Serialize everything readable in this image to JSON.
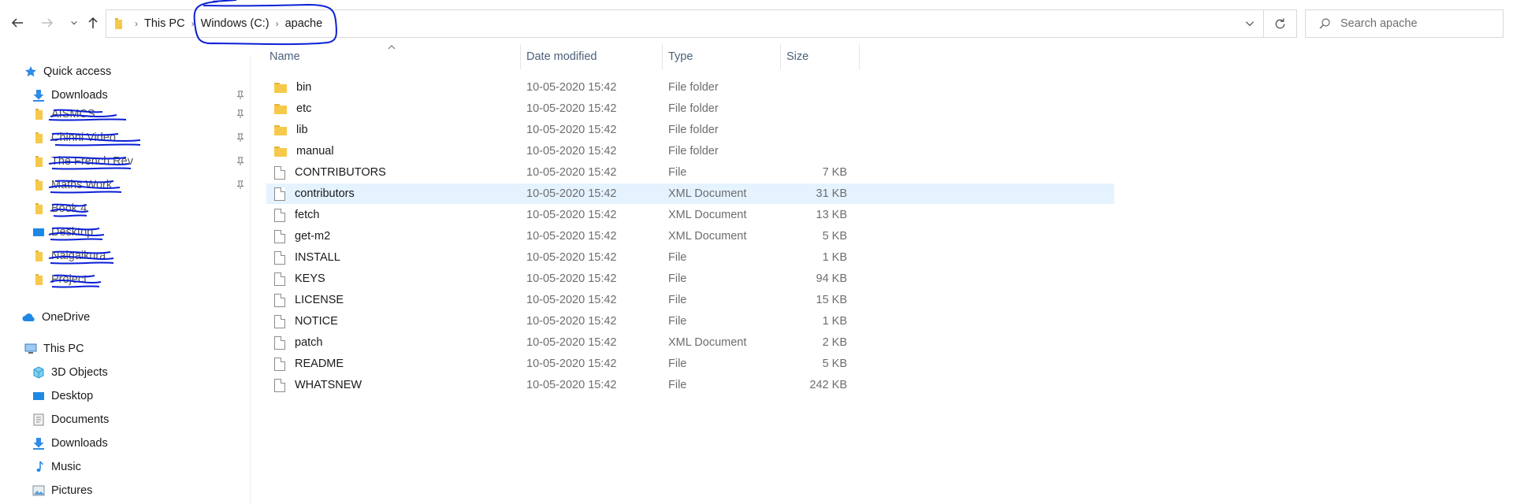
{
  "toolbar": {
    "breadcrumb": [
      "This PC",
      "Windows (C:)",
      "apache"
    ],
    "search_placeholder": "Search apache"
  },
  "nav": {
    "quick_access": "Quick access",
    "downloads_pinned": "Downloads",
    "redacted_items": [
      "AISMCS",
      "Chinni Video",
      "The French Rev",
      "Maths Work",
      "Book 4",
      "Desktop",
      "Nalgaikura",
      "Project"
    ],
    "onedrive": "OneDrive",
    "this_pc": "This PC",
    "pc_items": [
      "3D Objects",
      "Desktop",
      "Documents",
      "Downloads",
      "Music",
      "Pictures"
    ]
  },
  "columns": {
    "name": "Name",
    "date": "Date modified",
    "type": "Type",
    "size": "Size"
  },
  "files": [
    {
      "name": "bin",
      "date": "10-05-2020 15:42",
      "type": "File folder",
      "size": "",
      "kind": "folder"
    },
    {
      "name": "etc",
      "date": "10-05-2020 15:42",
      "type": "File folder",
      "size": "",
      "kind": "folder"
    },
    {
      "name": "lib",
      "date": "10-05-2020 15:42",
      "type": "File folder",
      "size": "",
      "kind": "folder"
    },
    {
      "name": "manual",
      "date": "10-05-2020 15:42",
      "type": "File folder",
      "size": "",
      "kind": "folder"
    },
    {
      "name": "CONTRIBUTORS",
      "date": "10-05-2020 15:42",
      "type": "File",
      "size": "7 KB",
      "kind": "file"
    },
    {
      "name": "contributors",
      "date": "10-05-2020 15:42",
      "type": "XML Document",
      "size": "31 KB",
      "kind": "file",
      "selected": true
    },
    {
      "name": "fetch",
      "date": "10-05-2020 15:42",
      "type": "XML Document",
      "size": "13 KB",
      "kind": "file"
    },
    {
      "name": "get-m2",
      "date": "10-05-2020 15:42",
      "type": "XML Document",
      "size": "5 KB",
      "kind": "file"
    },
    {
      "name": "INSTALL",
      "date": "10-05-2020 15:42",
      "type": "File",
      "size": "1 KB",
      "kind": "file"
    },
    {
      "name": "KEYS",
      "date": "10-05-2020 15:42",
      "type": "File",
      "size": "94 KB",
      "kind": "file"
    },
    {
      "name": "LICENSE",
      "date": "10-05-2020 15:42",
      "type": "File",
      "size": "15 KB",
      "kind": "file"
    },
    {
      "name": "NOTICE",
      "date": "10-05-2020 15:42",
      "type": "File",
      "size": "1 KB",
      "kind": "file"
    },
    {
      "name": "patch",
      "date": "10-05-2020 15:42",
      "type": "XML Document",
      "size": "2 KB",
      "kind": "file"
    },
    {
      "name": "README",
      "date": "10-05-2020 15:42",
      "type": "File",
      "size": "5 KB",
      "kind": "file"
    },
    {
      "name": "WHATSNEW",
      "date": "10-05-2020 15:42",
      "type": "File",
      "size": "242 KB",
      "kind": "file"
    }
  ],
  "colors": {
    "selection": "#e5f3ff",
    "header_text": "#4c607a",
    "annotation": "#0a1fd6",
    "folder": "#f6c94a"
  }
}
